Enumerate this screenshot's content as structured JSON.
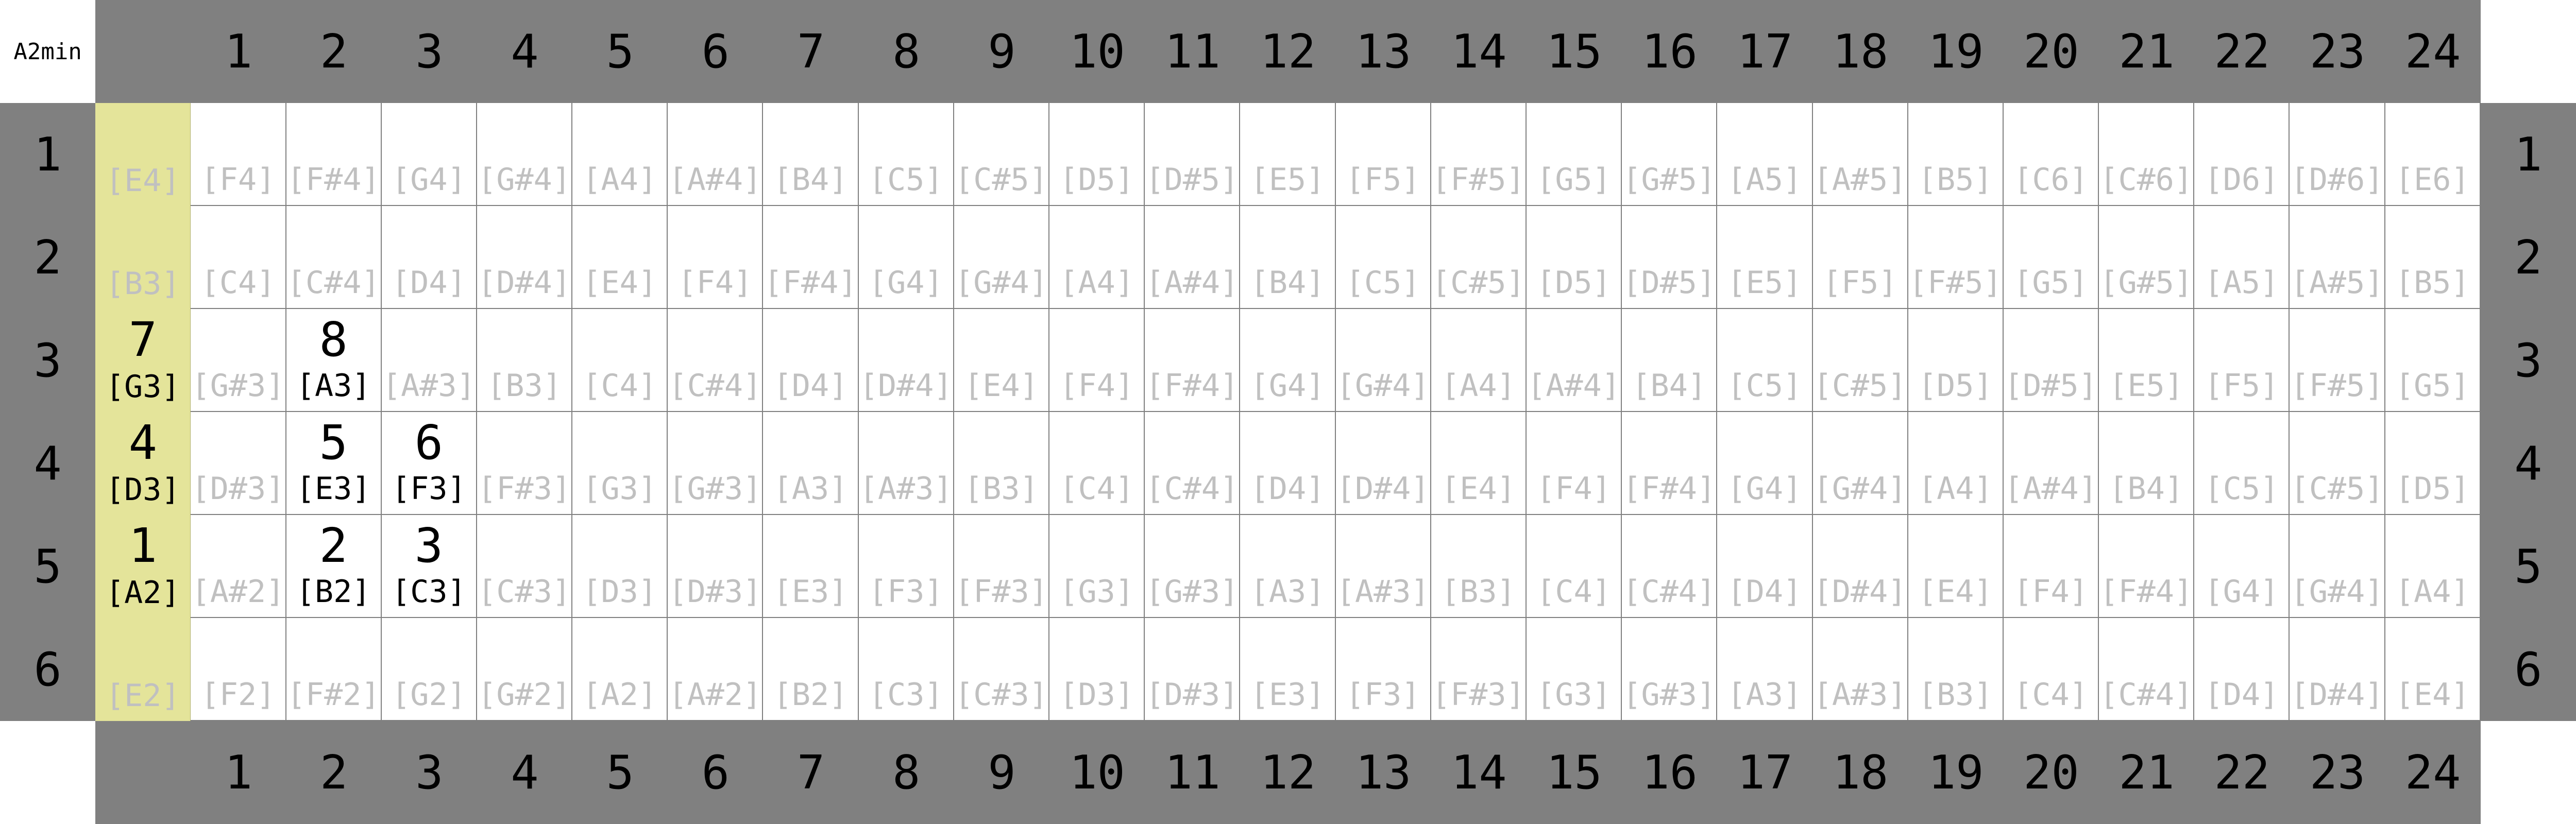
{
  "title": "A2min",
  "frets": [
    "1",
    "2",
    "3",
    "4",
    "5",
    "6",
    "7",
    "8",
    "9",
    "10",
    "11",
    "12",
    "13",
    "14",
    "15",
    "16",
    "17",
    "18",
    "19",
    "20",
    "21",
    "22",
    "23",
    "24"
  ],
  "strings": [
    "1",
    "2",
    "3",
    "4",
    "5",
    "6"
  ],
  "colors": {
    "bar": "#808080",
    "open_column": "#e4e49a",
    "muted_note": "#c0c0c0",
    "active_note": "#000000"
  },
  "notes": [
    [
      "[E4]",
      "[F4]",
      "[F#4]",
      "[G4]",
      "[G#4]",
      "[A4]",
      "[A#4]",
      "[B4]",
      "[C5]",
      "[C#5]",
      "[D5]",
      "[D#5]",
      "[E5]",
      "[F5]",
      "[F#5]",
      "[G5]",
      "[G#5]",
      "[A5]",
      "[A#5]",
      "[B5]",
      "[C6]",
      "[C#6]",
      "[D6]",
      "[D#6]",
      "[E6]"
    ],
    [
      "[B3]",
      "[C4]",
      "[C#4]",
      "[D4]",
      "[D#4]",
      "[E4]",
      "[F4]",
      "[F#4]",
      "[G4]",
      "[G#4]",
      "[A4]",
      "[A#4]",
      "[B4]",
      "[C5]",
      "[C#5]",
      "[D5]",
      "[D#5]",
      "[E5]",
      "[F5]",
      "[F#5]",
      "[G5]",
      "[G#5]",
      "[A5]",
      "[A#5]",
      "[B5]"
    ],
    [
      "[G3]",
      "[G#3]",
      "[A3]",
      "[A#3]",
      "[B3]",
      "[C4]",
      "[C#4]",
      "[D4]",
      "[D#4]",
      "[E4]",
      "[F4]",
      "[F#4]",
      "[G4]",
      "[G#4]",
      "[A4]",
      "[A#4]",
      "[B4]",
      "[C5]",
      "[C#5]",
      "[D5]",
      "[D#5]",
      "[E5]",
      "[F5]",
      "[F#5]",
      "[G5]"
    ],
    [
      "[D3]",
      "[D#3]",
      "[E3]",
      "[F3]",
      "[F#3]",
      "[G3]",
      "[G#3]",
      "[A3]",
      "[A#3]",
      "[B3]",
      "[C4]",
      "[C#4]",
      "[D4]",
      "[D#4]",
      "[E4]",
      "[F4]",
      "[F#4]",
      "[G4]",
      "[G#4]",
      "[A4]",
      "[A#4]",
      "[B4]",
      "[C5]",
      "[C#5]",
      "[D5]"
    ],
    [
      "[A2]",
      "[A#2]",
      "[B2]",
      "[C3]",
      "[C#3]",
      "[D3]",
      "[D#3]",
      "[E3]",
      "[F3]",
      "[F#3]",
      "[G3]",
      "[G#3]",
      "[A3]",
      "[A#3]",
      "[B3]",
      "[C4]",
      "[C#4]",
      "[D4]",
      "[D#4]",
      "[E4]",
      "[F4]",
      "[F#4]",
      "[G4]",
      "[G#4]",
      "[A4]"
    ],
    [
      "[E2]",
      "[F2]",
      "[F#2]",
      "[G2]",
      "[G#2]",
      "[A2]",
      "[A#2]",
      "[B2]",
      "[C3]",
      "[C#3]",
      "[D3]",
      "[D#3]",
      "[E3]",
      "[F3]",
      "[F#3]",
      "[G3]",
      "[G#3]",
      "[A3]",
      "[A#3]",
      "[B3]",
      "[C4]",
      "[C#4]",
      "[D4]",
      "[D#4]",
      "[E4]"
    ]
  ],
  "fingering": [
    {
      "string": 3,
      "fret": 0,
      "label": "7"
    },
    {
      "string": 3,
      "fret": 2,
      "label": "8"
    },
    {
      "string": 4,
      "fret": 0,
      "label": "4"
    },
    {
      "string": 4,
      "fret": 2,
      "label": "5"
    },
    {
      "string": 4,
      "fret": 3,
      "label": "6"
    },
    {
      "string": 5,
      "fret": 0,
      "label": "1"
    },
    {
      "string": 5,
      "fret": 2,
      "label": "2"
    },
    {
      "string": 5,
      "fret": 3,
      "label": "3"
    }
  ]
}
